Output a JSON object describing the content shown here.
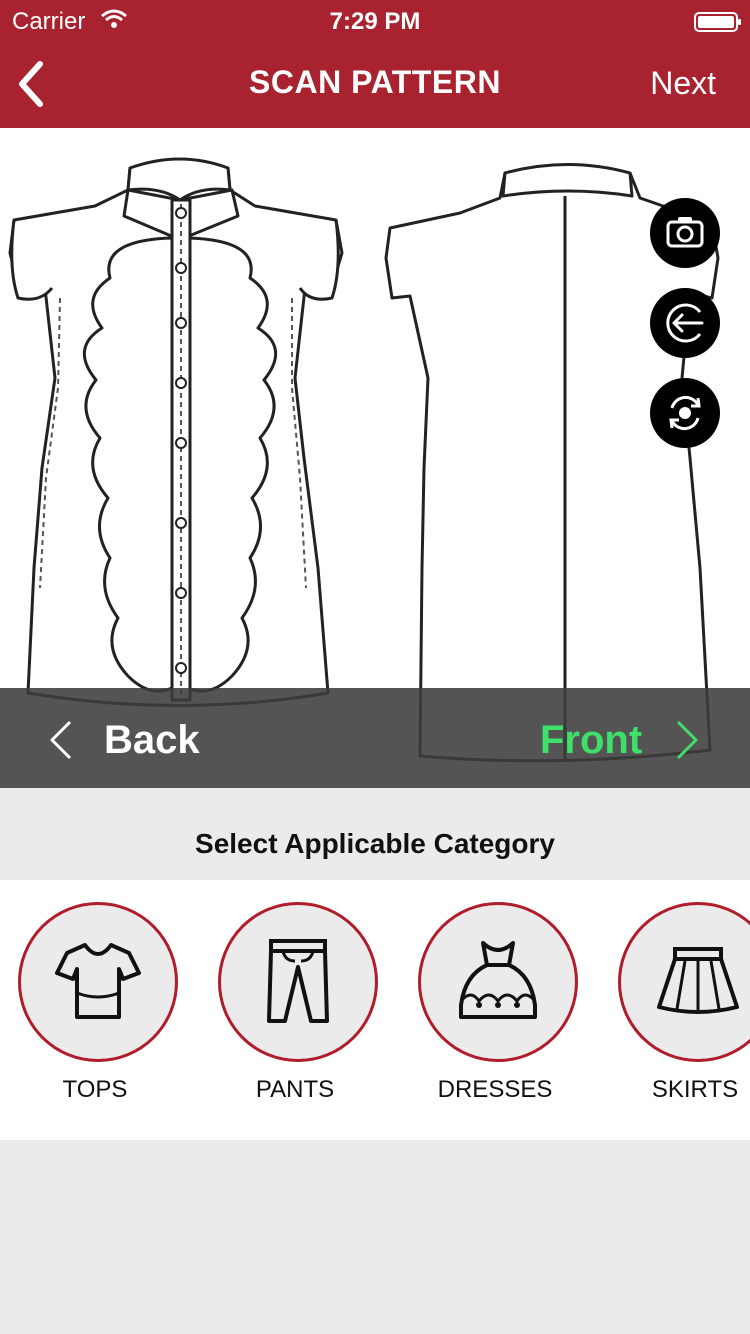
{
  "status_bar": {
    "carrier": "Carrier",
    "time": "7:29 PM"
  },
  "nav": {
    "title": "SCAN PATTERN",
    "next_label": "Next"
  },
  "view_toggle": {
    "back_label": "Back",
    "front_label": "Front"
  },
  "tools": [
    "camera-icon",
    "return-arrow-icon",
    "rotate-icon"
  ],
  "category_section": {
    "title": "Select Applicable Category",
    "items": [
      {
        "label": "TOPS",
        "icon": "top-icon"
      },
      {
        "label": "PANTS",
        "icon": "pants-icon"
      },
      {
        "label": "DRESSES",
        "icon": "dress-icon"
      },
      {
        "label": "SKIRTS",
        "icon": "skirt-icon"
      }
    ]
  },
  "colors": {
    "brand": "#a8232f",
    "active_view": "#3ee06a",
    "category_border": "#b01c2a",
    "background": "#ebebeb"
  }
}
